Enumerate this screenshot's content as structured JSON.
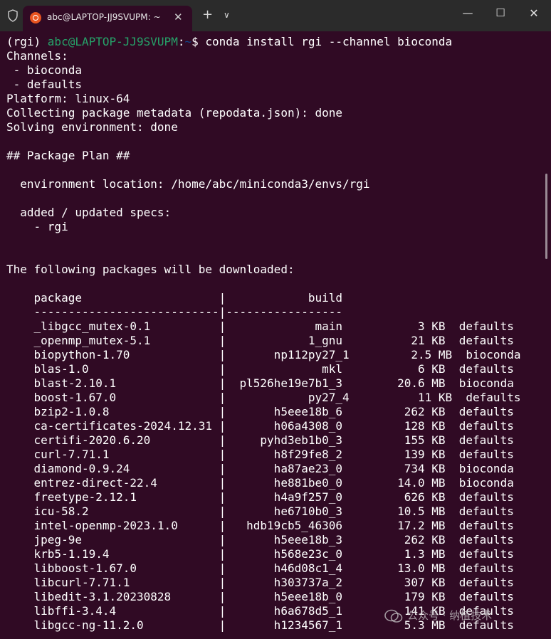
{
  "window": {
    "tab_title": "abc@LAPTOP-JJ9SVUPM: ~",
    "tab_close": "✕",
    "new_tab": "+",
    "tab_menu": "∨",
    "minimize": "—",
    "maximize": "☐",
    "close": "✕"
  },
  "prompt": {
    "env": "(rgi) ",
    "user": "abc@LAPTOP-JJ9SVUPM",
    "colon": ":",
    "path": "~",
    "dollar": "$ ",
    "command": "conda install rgi --channel bioconda"
  },
  "output_lines": [
    "Channels:",
    " - bioconda",
    " - defaults",
    "Platform: linux-64",
    "Collecting package metadata (repodata.json): done",
    "Solving environment: done",
    "",
    "## Package Plan ##",
    "",
    "  environment location: /home/abc/miniconda3/envs/rgi",
    "",
    "  added / updated specs:",
    "    - rgi",
    "",
    "",
    "The following packages will be downloaded:",
    "",
    "    package                    |            build",
    "    ---------------------------|-----------------",
    "    _libgcc_mutex-0.1          |             main           3 KB  defaults",
    "    _openmp_mutex-5.1          |            1_gnu          21 KB  defaults",
    "    biopython-1.70             |       np112py27_1         2.5 MB  bioconda",
    "    blas-1.0                   |              mkl           6 KB  defaults",
    "    blast-2.10.1               |  pl526he19e7b1_3        20.6 MB  bioconda",
    "    boost-1.67.0               |            py27_4          11 KB  defaults",
    "    bzip2-1.0.8                |       h5eee18b_6         262 KB  defaults",
    "    ca-certificates-2024.12.31 |       h06a4308_0         128 KB  defaults",
    "    certifi-2020.6.20          |     pyhd3eb1b0_3         155 KB  defaults",
    "    curl-7.71.1                |       h8f29fe8_2         139 KB  defaults",
    "    diamond-0.9.24             |       ha87ae23_0         734 KB  bioconda",
    "    entrez-direct-22.4         |       he881be0_0        14.0 MB  bioconda",
    "    freetype-2.12.1            |       h4a9f257_0         626 KB  defaults",
    "    icu-58.2                   |       he6710b0_3        10.5 MB  defaults",
    "    intel-openmp-2023.1.0      |   hdb19cb5_46306        17.2 MB  defaults",
    "    jpeg-9e                    |       h5eee18b_3         262 KB  defaults",
    "    krb5-1.19.4                |       h568e23c_0         1.3 MB  defaults",
    "    libboost-1.67.0            |       h46d08c1_4        13.0 MB  defaults",
    "    libcurl-7.71.1             |       h303737a_2         307 KB  defaults",
    "    libedit-3.1.20230828       |       h5eee18b_0         179 KB  defaults",
    "    libffi-3.4.4               |       h6a678d5_1         141 KB  defaults",
    "    libgcc-ng-11.2.0           |       h1234567_1         5.3 MB  defaults"
  ],
  "watermark": "公众号 · 纳植技术"
}
